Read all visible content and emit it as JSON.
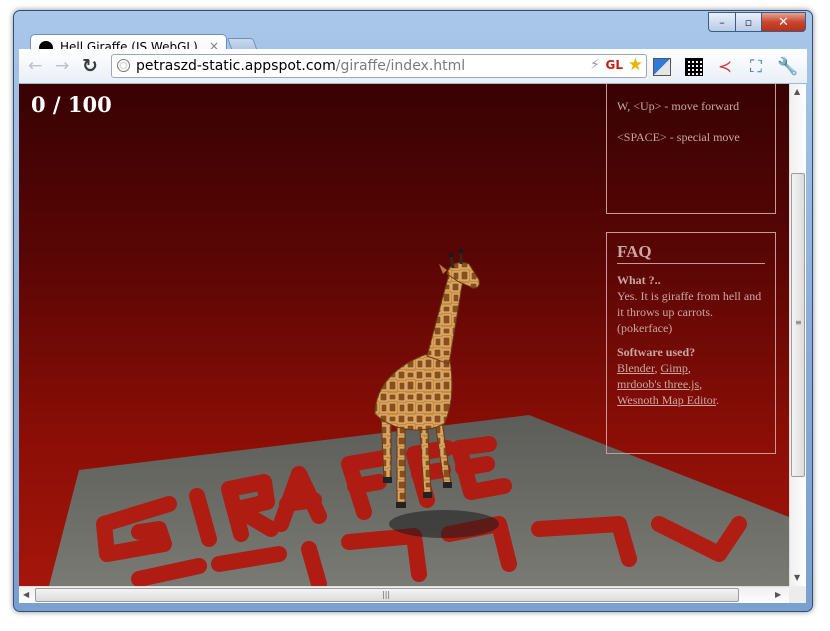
{
  "tab": {
    "title": "Hell Giraffe (JS WebGL)",
    "close_glyph": "×"
  },
  "toolbar": {
    "back_glyph": "←",
    "forward_glyph": "→",
    "reload_glyph": "↻",
    "url_host": "petraszd-static.appspot.com",
    "url_path": "/giraffe/index.html",
    "gl_badge": "GL",
    "bolt_glyph": "⚡",
    "star_glyph": "★",
    "share_glyph": "≺",
    "fullscreen_glyph": "⛶",
    "wrench_glyph": "🔧"
  },
  "window_controls": {
    "minimize": "–",
    "maximize": "▫",
    "close": "✕"
  },
  "game": {
    "score": "0 / 100",
    "controls": [
      "W, <Up> - move forward",
      "<SPACE> - special move"
    ],
    "floor_text": "GIRAFFE"
  },
  "faq": {
    "title": "FAQ",
    "q1": "What ?..",
    "a1": "Yes. It is giraffe from hell and it throws up carrots. (pokerface)",
    "q2": "Software used?",
    "links": [
      "Blender",
      "Gimp",
      "mrdoob's three.js",
      "Wesnoth Map Editor"
    ]
  },
  "colors": {
    "sky_top": "#380203",
    "sky_bottom": "#a5160b",
    "floor": "#6d6d67",
    "lava": "#b3180e",
    "panel_text": "#c9a8a4"
  }
}
